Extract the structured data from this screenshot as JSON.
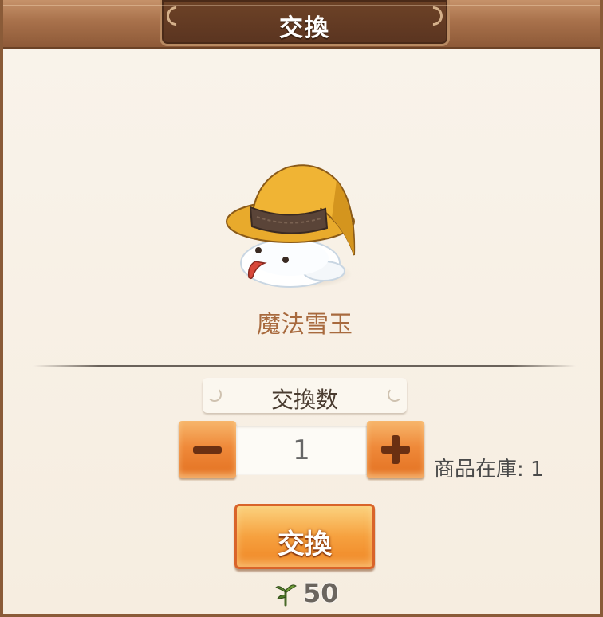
{
  "dialog": {
    "title": "交換"
  },
  "item": {
    "name": "魔法雪玉",
    "icon": "snowball-with-witch-hat"
  },
  "quantity": {
    "label": "交換数",
    "value": "1",
    "decrement_icon": "minus-icon",
    "increment_icon": "plus-icon"
  },
  "stock": {
    "text": "商品在庫: 1"
  },
  "exchange_button": {
    "label": "交換"
  },
  "cost": {
    "icon": "currency-icon",
    "amount": "50"
  },
  "colors": {
    "frame": "#8a5b38",
    "title_plate": "#5a3420",
    "item_name": "#a86a3e",
    "button_orange": "#ef8524",
    "panel": "#f8f1e6"
  }
}
